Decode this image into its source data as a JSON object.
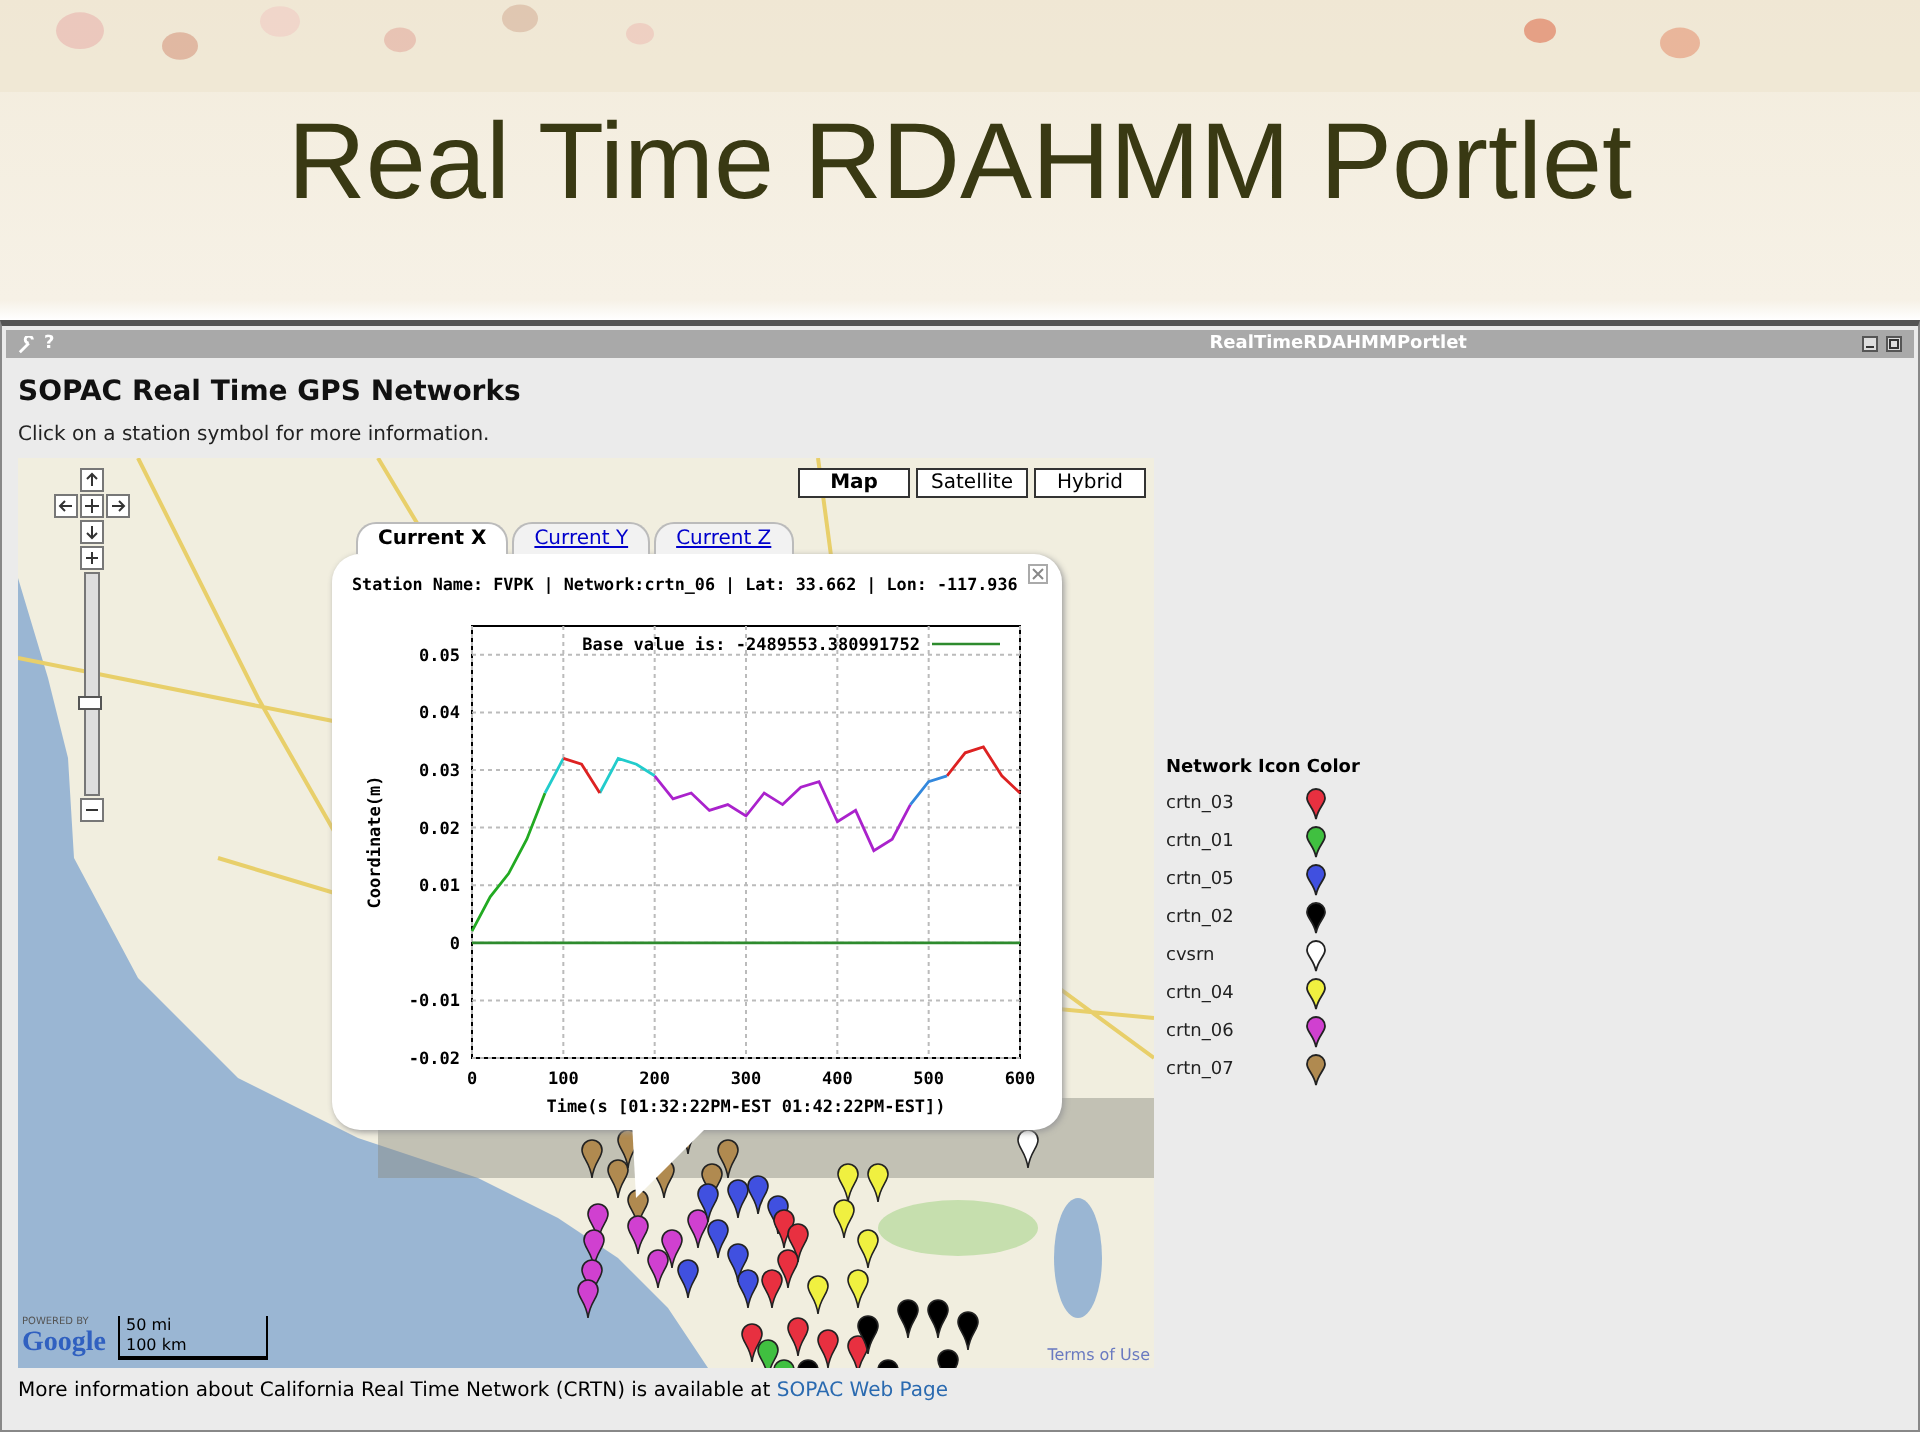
{
  "slide": {
    "title": "Real Time RDAHMM Portlet"
  },
  "portlet": {
    "title": "RealTimeRDAHMMPortlet",
    "help": "?",
    "heading": "SOPAC Real Time GPS Networks",
    "instruction": "Click on a station symbol for more information.",
    "map": {
      "map_types": [
        {
          "label": "Map",
          "selected": true
        },
        {
          "label": "Satellite",
          "selected": false
        },
        {
          "label": "Hybrid",
          "selected": false
        }
      ],
      "zoom_slider": {
        "level": 0.42
      },
      "attribution": {
        "powered_by": "POWERED BY",
        "logo": "Google",
        "scale_miles": "50 mi",
        "scale_km": "100 km",
        "terms": "Terms of Use"
      },
      "popup": {
        "tabs": [
          {
            "label": "Current X",
            "selected": true
          },
          {
            "label": "Current Y",
            "selected": false
          },
          {
            "label": "Current Z",
            "selected": false
          }
        ],
        "station_info": "Station Name: FVPK | Network:crtn_06 | Lat: 33.662 | Lon: -117.936",
        "chart_data": {
          "type": "line",
          "xlabel": "Time(s [01:32:22PM-EST 01:42:22PM-EST])",
          "ylabel": "Coordinate(m)",
          "x": [
            0,
            20,
            40,
            60,
            80,
            100,
            120,
            140,
            160,
            180,
            200,
            220,
            240,
            260,
            280,
            300,
            320,
            340,
            360,
            380,
            400,
            420,
            440,
            460,
            480,
            500,
            520,
            540,
            560,
            580,
            600
          ],
          "series": [
            {
              "name": "Base value is: -2489553.380991752",
              "color": "#2e8b2e",
              "values": [
                0,
                0,
                0,
                0,
                0,
                0,
                0,
                0,
                0,
                0,
                0,
                0,
                0,
                0,
                0,
                0,
                0,
                0,
                0,
                0,
                0,
                0,
                0,
                0,
                0,
                0,
                0,
                0,
                0,
                0,
                0
              ]
            },
            {
              "color": "#22aa22",
              "values": [
                0.002,
                0.008,
                0.012,
                0.018,
                0.026,
                null,
                null,
                null,
                null,
                null,
                null,
                null,
                null,
                null,
                null,
                null,
                null,
                null,
                null,
                null,
                null,
                null,
                null,
                null,
                null,
                null,
                null,
                null,
                null,
                null,
                null
              ]
            },
            {
              "color": "#22cccc",
              "values": [
                null,
                null,
                null,
                null,
                0.026,
                0.032,
                null,
                0.026,
                0.032,
                0.031,
                0.029,
                null,
                null,
                null,
                null,
                null,
                null,
                null,
                null,
                null,
                null,
                null,
                null,
                null,
                null,
                null,
                null,
                null,
                null,
                null,
                null
              ]
            },
            {
              "color": "#dd2222",
              "values": [
                null,
                null,
                null,
                null,
                null,
                0.032,
                0.031,
                0.026,
                null,
                null,
                null,
                null,
                null,
                null,
                null,
                null,
                null,
                null,
                null,
                null,
                null,
                null,
                null,
                null,
                null,
                null,
                0.029,
                0.033,
                0.034,
                0.029,
                0.026
              ]
            },
            {
              "color": "#aa22cc",
              "values": [
                null,
                null,
                null,
                null,
                null,
                null,
                null,
                null,
                null,
                null,
                0.029,
                0.025,
                0.026,
                0.023,
                0.024,
                0.022,
                0.026,
                0.024,
                0.027,
                0.028,
                0.021,
                0.023,
                0.016,
                0.018,
                0.024,
                null,
                null,
                null,
                null,
                null,
                null
              ]
            },
            {
              "color": "#3388dd",
              "values": [
                null,
                null,
                null,
                null,
                null,
                null,
                null,
                null,
                null,
                null,
                null,
                null,
                null,
                null,
                null,
                null,
                null,
                null,
                null,
                null,
                null,
                null,
                null,
                null,
                0.024,
                0.028,
                0.029,
                null,
                null,
                null,
                null
              ]
            }
          ],
          "grid": true,
          "xlim": [
            0,
            600
          ],
          "ylim": [
            -0.02,
            0.055
          ],
          "xticks": [
            0,
            100,
            200,
            300,
            400,
            500,
            600
          ],
          "yticks": [
            -0.02,
            -0.01,
            0,
            0.01,
            0.02,
            0.03,
            0.04,
            0.05
          ]
        }
      }
    },
    "legend": {
      "title": "Network Icon Color",
      "items": [
        {
          "label": "crtn_03",
          "color": "#e83040"
        },
        {
          "label": "crtn_01",
          "color": "#40c040"
        },
        {
          "label": "crtn_05",
          "color": "#4050e0"
        },
        {
          "label": "crtn_02",
          "color": "#000000"
        },
        {
          "label": "cvsrn",
          "color": "#ffffff"
        },
        {
          "label": "crtn_04",
          "color": "#f0f040"
        },
        {
          "label": "crtn_06",
          "color": "#d040d0"
        },
        {
          "label": "crtn_07",
          "color": "#b08a50"
        }
      ]
    },
    "footer": {
      "text": "More information about California Real Time Network (CRTN) is available at ",
      "link": "SOPAC Web Page"
    }
  }
}
